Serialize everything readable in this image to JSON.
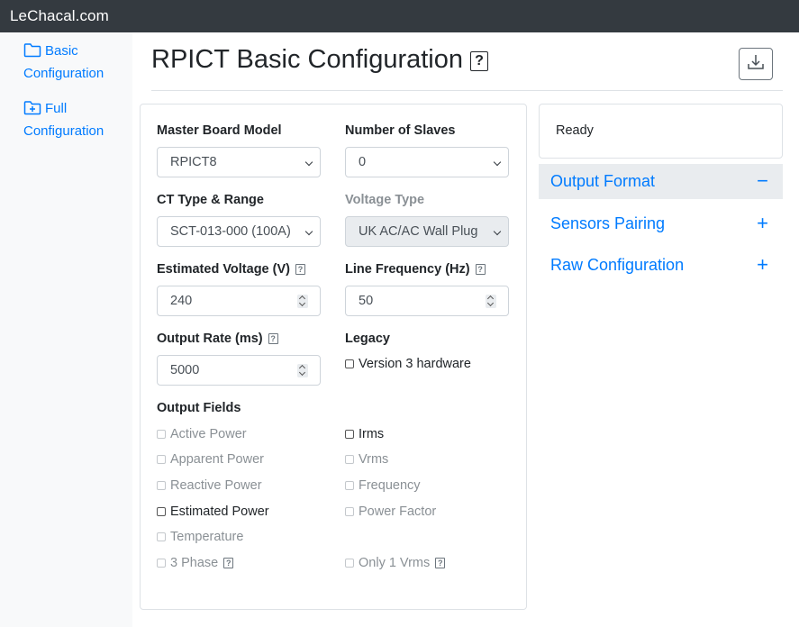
{
  "app": {
    "brand": "LeChacal.com"
  },
  "sidebar": {
    "items": [
      {
        "label": "Basic Configuration",
        "icon": "folder-icon"
      },
      {
        "label": "Full Configuration",
        "icon": "folder-plus-icon"
      }
    ]
  },
  "page": {
    "title": "RPICT Basic Configuration",
    "help_glyph": "?"
  },
  "form": {
    "master_board": {
      "label": "Master Board Model",
      "value": "RPICT8"
    },
    "num_slaves": {
      "label": "Number of Slaves",
      "value": "0"
    },
    "ct_type": {
      "label": "CT Type & Range",
      "value": "SCT-013-000 (100A)"
    },
    "voltage_type": {
      "label": "Voltage Type",
      "value": "UK AC/AC Wall Plug",
      "disabled": true
    },
    "est_voltage": {
      "label": "Estimated Voltage (V)",
      "value": "240"
    },
    "line_freq": {
      "label": "Line Frequency (Hz)",
      "value": "50"
    },
    "output_rate": {
      "label": "Output Rate (ms)",
      "value": "5000"
    },
    "legacy": {
      "label": "Legacy",
      "option": "Version 3 hardware",
      "checked": false
    },
    "output_fields": {
      "label": "Output Fields",
      "left": [
        {
          "label": "Active Power",
          "enabled": false
        },
        {
          "label": "Apparent Power",
          "enabled": false
        },
        {
          "label": "Reactive Power",
          "enabled": false
        },
        {
          "label": "Estimated Power",
          "enabled": true
        },
        {
          "label": "Temperature",
          "enabled": false
        },
        {
          "label": "3 Phase",
          "enabled": false,
          "help": true
        }
      ],
      "right": [
        {
          "label": "Irms",
          "enabled": true
        },
        {
          "label": "Vrms",
          "enabled": false
        },
        {
          "label": "Frequency",
          "enabled": false
        },
        {
          "label": "Power Factor",
          "enabled": false
        },
        {
          "label": "Only 1 Vrms",
          "enabled": false,
          "help": true
        }
      ]
    }
  },
  "status": {
    "text": "Ready"
  },
  "accordion": [
    {
      "label": "Output Format",
      "sign": "−",
      "open": true
    },
    {
      "label": "Sensors Pairing",
      "sign": "+",
      "open": false
    },
    {
      "label": "Raw Configuration",
      "sign": "+",
      "open": false
    }
  ],
  "colors": {
    "topbar": "#343a40",
    "link": "#007bff",
    "sidebar_bg": "#f8f9fa"
  }
}
